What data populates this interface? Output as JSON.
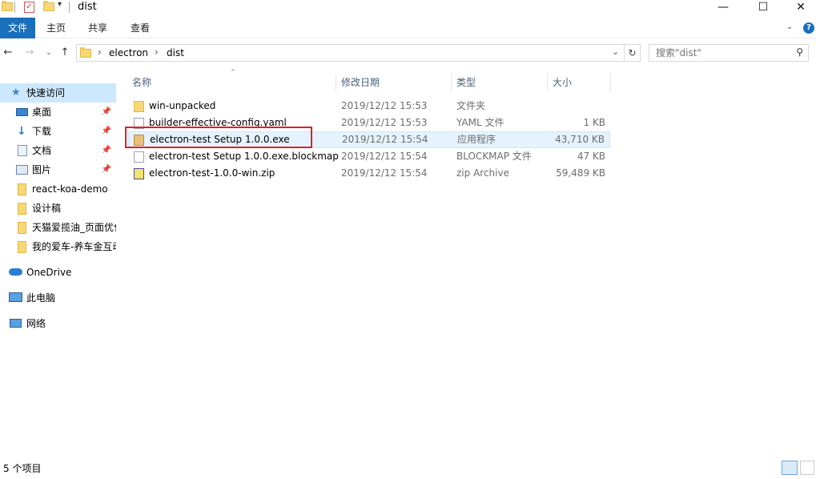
{
  "window": {
    "title": "dist",
    "controls": {
      "minimize": "—",
      "maximize": "☐",
      "close": "✕"
    }
  },
  "ribbon": {
    "tabs": [
      {
        "label": "文件"
      },
      {
        "label": "主页"
      },
      {
        "label": "共享"
      },
      {
        "label": "查看"
      }
    ]
  },
  "nav": {
    "breadcrumb": [
      "electron",
      "dist"
    ],
    "separator": "›",
    "search_placeholder": "搜索\"dist\""
  },
  "sidebar": {
    "items": [
      {
        "label": "快速访问",
        "icon": "star-icon",
        "pinned": false
      },
      {
        "label": "桌面",
        "icon": "desktop-icon",
        "pinned": true
      },
      {
        "label": "下载",
        "icon": "download-icon",
        "pinned": true
      },
      {
        "label": "文档",
        "icon": "document-icon",
        "pinned": true
      },
      {
        "label": "图片",
        "icon": "picture-icon",
        "pinned": true
      },
      {
        "label": "react-koa-demo",
        "icon": "folder-icon",
        "pinned": false
      },
      {
        "label": "设计稿",
        "icon": "folder-icon",
        "pinned": false
      },
      {
        "label": "天猫爱揽油_页面优化",
        "icon": "folder-icon",
        "pinned": false
      },
      {
        "label": "我的爱车-养车金互动",
        "icon": "folder-icon",
        "pinned": false
      },
      {
        "label": "OneDrive",
        "icon": "cloud-icon",
        "pinned": false
      },
      {
        "label": "此电脑",
        "icon": "computer-icon",
        "pinned": false
      },
      {
        "label": "网络",
        "icon": "network-icon",
        "pinned": false
      }
    ]
  },
  "table": {
    "columns": [
      "名称",
      "修改日期",
      "类型",
      "大小"
    ],
    "rows": [
      {
        "name": "win-unpacked",
        "date": "2019/12/12 15:53",
        "type": "文件夹",
        "size": "",
        "icon": "folder-icon"
      },
      {
        "name": "builder-effective-config.yaml",
        "date": "2019/12/12 15:53",
        "type": "YAML 文件",
        "size": "1 KB",
        "icon": "file-icon"
      },
      {
        "name": "electron-test Setup 1.0.0.exe",
        "date": "2019/12/12 15:54",
        "type": "应用程序",
        "size": "43,710 KB",
        "icon": "installer-icon"
      },
      {
        "name": "electron-test Setup 1.0.0.exe.blockmap",
        "date": "2019/12/12 15:54",
        "type": "BLOCKMAP 文件",
        "size": "47 KB",
        "icon": "file-icon"
      },
      {
        "name": "electron-test-1.0.0-win.zip",
        "date": "2019/12/12 15:54",
        "type": "zip Archive",
        "size": "59,489 KB",
        "icon": "zip-icon"
      }
    ]
  },
  "status": {
    "item_count": "5 个项目"
  },
  "colors": {
    "accent": "#1a6fbd",
    "selection": "#cce8ff",
    "hover_row": "#e5f3ff",
    "highlight_box": "#e02020"
  }
}
